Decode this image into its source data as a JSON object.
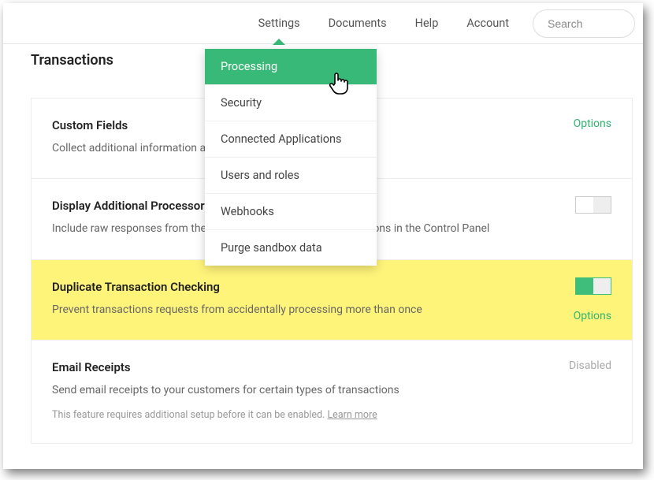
{
  "nav": {
    "settings": "Settings",
    "documents": "Documents",
    "help": "Help",
    "account": "Account",
    "search_placeholder": "Search"
  },
  "page": {
    "title": "Transactions"
  },
  "dropdown": {
    "items": [
      "Processing",
      "Security",
      "Connected Applications",
      "Users and roles",
      "Webhooks",
      "Purge sandbox data"
    ]
  },
  "cards": {
    "custom_fields": {
      "title": "Custom Fields",
      "sub": "Collect additional information about your customers' purchases",
      "options": "Options"
    },
    "display_proc": {
      "title": "Display Additional Processor Response",
      "sub": "Include raw responses from the processor when viewing transactions in the Control Panel"
    },
    "dup_check": {
      "title": "Duplicate Transaction Checking",
      "sub": "Prevent transactions requests from accidentally processing more than once",
      "options": "Options"
    },
    "email_receipts": {
      "title": "Email Receipts",
      "sub": "Send email receipts to your customers for certain types of transactions",
      "note_a": "This feature requires additional setup before it can be enabled. ",
      "note_b": "Learn more",
      "disabled": "Disabled"
    }
  }
}
